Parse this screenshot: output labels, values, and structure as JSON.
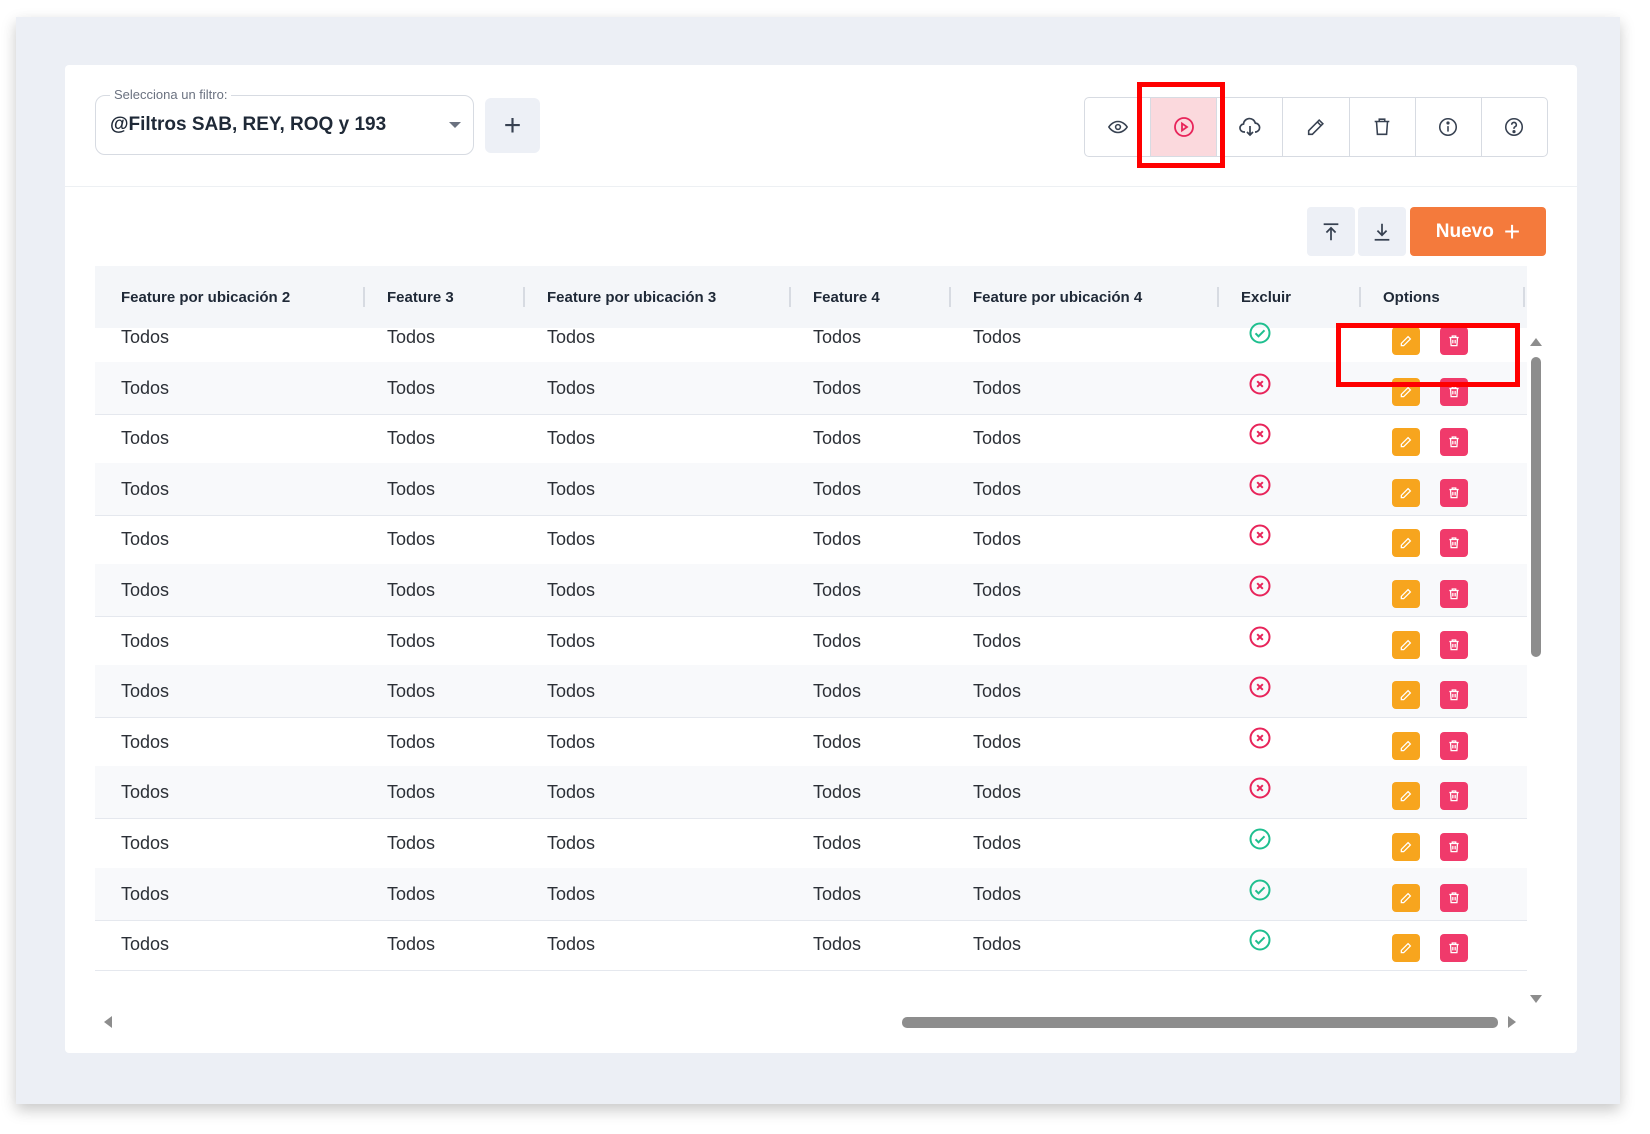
{
  "filter": {
    "label": "Selecciona un filtro:",
    "value": "@Filtros SAB, REY, ROQ y 193",
    "add_label": "+"
  },
  "toolbar": {
    "buttons": [
      {
        "icon": "eye-icon",
        "active": false
      },
      {
        "icon": "play-circle-icon",
        "active": true
      },
      {
        "icon": "cloud-download-icon",
        "active": false
      },
      {
        "icon": "pencil-icon",
        "active": false
      },
      {
        "icon": "trash-icon",
        "active": false
      },
      {
        "icon": "info-icon",
        "active": false
      },
      {
        "icon": "help-icon",
        "active": false
      }
    ]
  },
  "actions": {
    "upload_icon": "upload-icon",
    "download_icon": "download-icon",
    "new_label": "Nuevo",
    "new_plus": "+"
  },
  "colors": {
    "accent": "#f47a3c",
    "active_bg": "#fbd9dd",
    "active_fg": "#e8245a",
    "check": "#1fbf8f",
    "cross": "#e8245a",
    "edit": "#f7a51e",
    "delete": "#f03a6b",
    "highlight": "#ff0000"
  },
  "table": {
    "columns": [
      "Feature por ubicación 2",
      "Feature 3",
      "Feature por ubicación 3",
      "Feature 4",
      "Feature por ubicación 4",
      "Excluir",
      "Options"
    ],
    "rows": [
      {
        "cells": [
          "Todos",
          "Todos",
          "Todos",
          "Todos",
          "Todos"
        ],
        "excluir": "check"
      },
      {
        "cells": [
          "Todos",
          "Todos",
          "Todos",
          "Todos",
          "Todos"
        ],
        "excluir": "cross"
      },
      {
        "cells": [
          "Todos",
          "Todos",
          "Todos",
          "Todos",
          "Todos"
        ],
        "excluir": "cross"
      },
      {
        "cells": [
          "Todos",
          "Todos",
          "Todos",
          "Todos",
          "Todos"
        ],
        "excluir": "cross"
      },
      {
        "cells": [
          "Todos",
          "Todos",
          "Todos",
          "Todos",
          "Todos"
        ],
        "excluir": "cross"
      },
      {
        "cells": [
          "Todos",
          "Todos",
          "Todos",
          "Todos",
          "Todos"
        ],
        "excluir": "cross"
      },
      {
        "cells": [
          "Todos",
          "Todos",
          "Todos",
          "Todos",
          "Todos"
        ],
        "excluir": "cross"
      },
      {
        "cells": [
          "Todos",
          "Todos",
          "Todos",
          "Todos",
          "Todos"
        ],
        "excluir": "cross"
      },
      {
        "cells": [
          "Todos",
          "Todos",
          "Todos",
          "Todos",
          "Todos"
        ],
        "excluir": "cross"
      },
      {
        "cells": [
          "Todos",
          "Todos",
          "Todos",
          "Todos",
          "Todos"
        ],
        "excluir": "cross"
      },
      {
        "cells": [
          "Todos",
          "Todos",
          "Todos",
          "Todos",
          "Todos"
        ],
        "excluir": "check"
      },
      {
        "cells": [
          "Todos",
          "Todos",
          "Todos",
          "Todos",
          "Todos"
        ],
        "excluir": "check"
      },
      {
        "cells": [
          "Todos",
          "Todos",
          "Todos",
          "Todos",
          "Todos"
        ],
        "excluir": "check"
      }
    ]
  }
}
